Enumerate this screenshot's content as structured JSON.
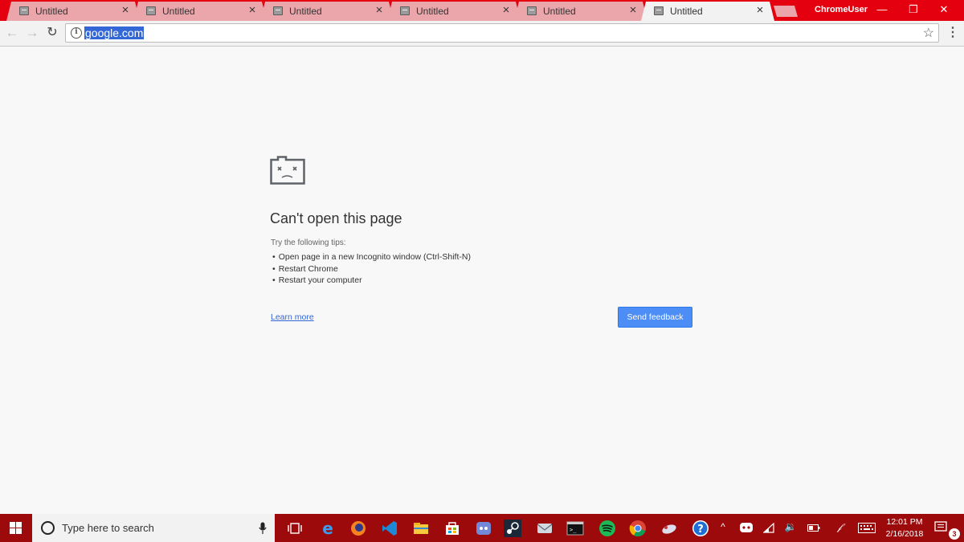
{
  "browser": {
    "tabs": [
      {
        "title": "Untitled",
        "close": "×"
      },
      {
        "title": "Untitled",
        "close": "×"
      },
      {
        "title": "Untitled",
        "close": "×"
      },
      {
        "title": "Untitled",
        "close": "×"
      },
      {
        "title": "Untitled",
        "close": "×"
      },
      {
        "title": "Untitled",
        "close": "×"
      }
    ],
    "profile_name": "ChromeUser",
    "window_controls": {
      "minimize": "—",
      "restore": "❐",
      "close": "✕"
    },
    "url": "google.com",
    "colors": {
      "titlebar": "#e4000f",
      "inactive_tab": "#eba6ab",
      "selection": "#3367d6"
    }
  },
  "error_page": {
    "icon": "sad-tab-icon",
    "heading": "Can't open this page",
    "tips_intro": "Try the following tips:",
    "tips": [
      "Open page in a new Incognito window (Ctrl-Shift-N)",
      "Restart Chrome",
      "Restart your computer"
    ],
    "learn_more": "Learn more",
    "feedback_button": "Send feedback",
    "colors": {
      "button": "#4c8df6",
      "link": "#3367d6"
    }
  },
  "taskbar": {
    "search_placeholder": "Type here to search",
    "apps": [
      "task-view",
      "edge",
      "firefox",
      "vscode",
      "file-explorer",
      "store",
      "discord",
      "steam",
      "mail",
      "terminal",
      "spotify",
      "chrome",
      "app-bird",
      "help"
    ],
    "tray_icons": [
      "chevron-up",
      "discord",
      "wifi",
      "volume",
      "battery",
      "pen",
      "keyboard"
    ],
    "time": "12:01 PM",
    "date": "2/16/2018",
    "notification_count": "3",
    "color": "#9c0a0c"
  }
}
